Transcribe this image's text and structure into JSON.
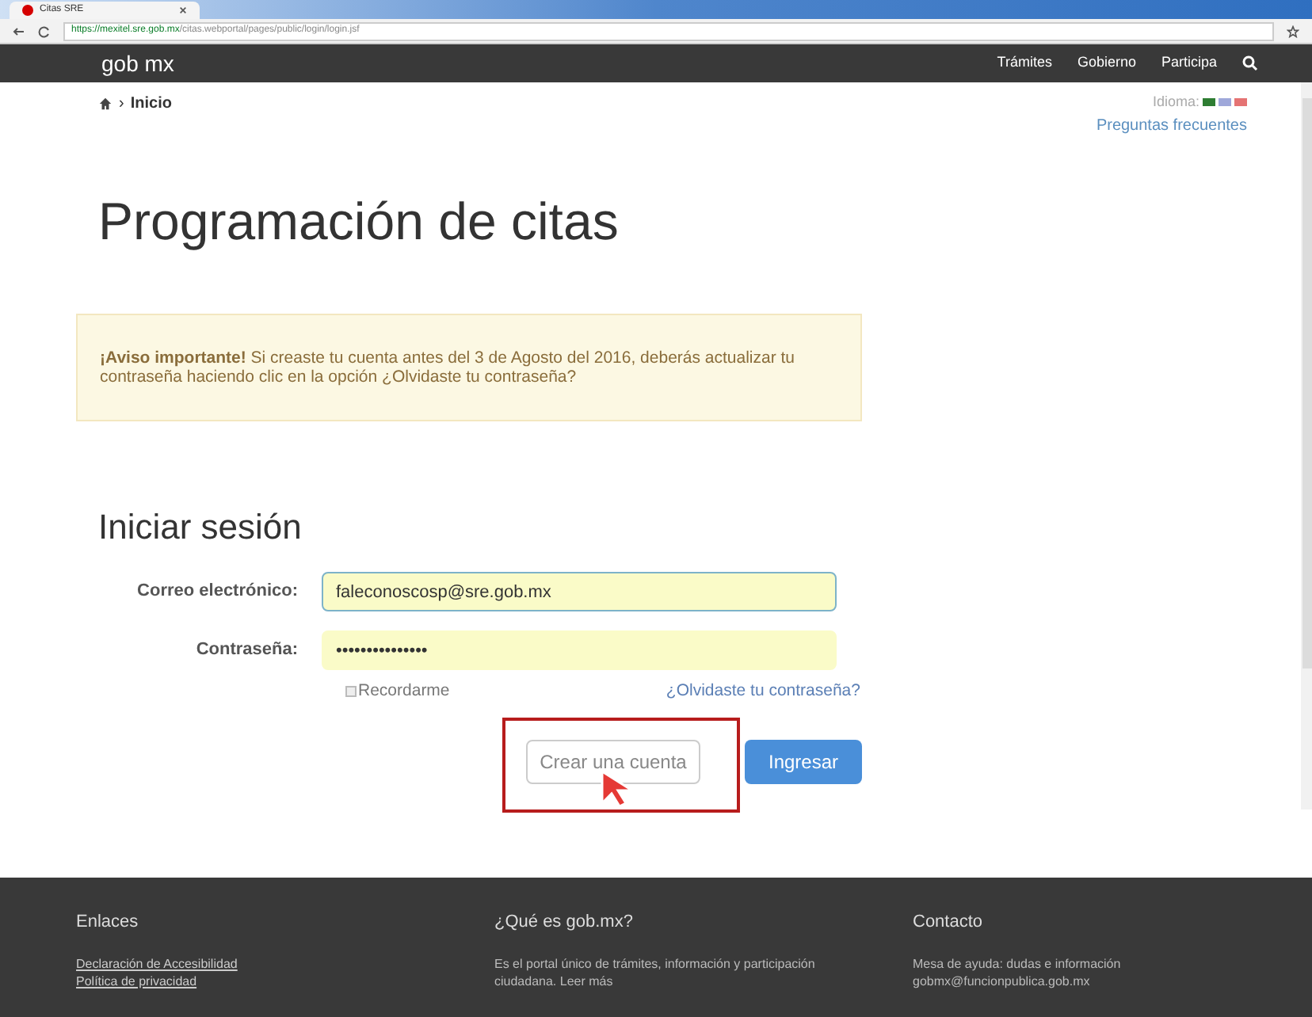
{
  "browser": {
    "tab_title": "Citas SRE",
    "url_host": "https://mexitel.sre.gob.mx",
    "url_path": "/citas.webportal/pages/public/login/login.jsf"
  },
  "navbar": {
    "logo": "gob mx",
    "links": [
      "Trámites",
      "Gobierno",
      "Participa"
    ]
  },
  "breadcrumb": {
    "separator": "›",
    "current": "Inicio"
  },
  "language": {
    "label": "Idioma:",
    "flags": [
      {
        "color": "#2e7d32"
      },
      {
        "color": "#9fa8da"
      },
      {
        "color": "#e57373"
      }
    ]
  },
  "faq_link": "Preguntas frecuentes",
  "page_title": "Programación de citas",
  "notice": "**¡Aviso importante!** Si creaste tu cuenta antes del 3 de Agosto del 2016, deberás actualizar tu contraseña haciendo clic en la opción ¿Olvidaste tu contraseña?",
  "login": {
    "title": "Iniciar sesión",
    "fields": [
      {
        "label": "Correo electrónico:",
        "value": "faleconoscosp@sre.gob.mx",
        "focused": true
      },
      {
        "label": "Contraseña:",
        "value": "•••••••••••••••",
        "focused": false
      }
    ],
    "remember": {
      "label": "Recordarme",
      "checked": false
    },
    "forgot_link": "¿Olvidaste tu contraseña?",
    "buttons": [
      {
        "label": "Crear una cuenta",
        "kind": "secondary",
        "highlighted": true
      },
      {
        "label": "Ingresar",
        "kind": "primary",
        "highlighted": false
      }
    ]
  },
  "footer": {
    "columns": [
      {
        "heading": "Enlaces",
        "lines": [
          {
            "text": "Declaración de Accesibilidad",
            "kind": "link"
          },
          {
            "text": "Política de privacidad",
            "kind": "link"
          }
        ]
      },
      {
        "heading": "¿Qué es gob.mx?",
        "lines": [
          {
            "text": "Es el portal único de trámites, información y participación ciudadana. Leer más",
            "kind": "text"
          }
        ]
      },
      {
        "heading": "Contacto",
        "lines": [
          {
            "text": "Mesa de ayuda: dudas e información",
            "kind": "text"
          },
          {
            "text": "gobmx@funcionpublica.gob.mx",
            "kind": "text"
          }
        ]
      }
    ]
  }
}
